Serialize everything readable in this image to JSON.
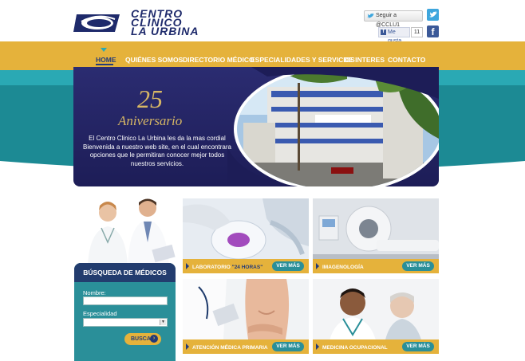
{
  "brand": {
    "line1": "CENTRO",
    "line2": "CLINICO",
    "line3": "LA URBINA"
  },
  "social": {
    "twitter_follow": "Seguir a @CCLU1",
    "facebook_like": "Me gusta",
    "facebook_count": "11",
    "facebook_letter": "f"
  },
  "nav": {
    "items": [
      {
        "label": "HOME"
      },
      {
        "label": "QUIÉNES SOMOS"
      },
      {
        "label": "DIRECTORIO MÉDICO"
      },
      {
        "label": "ESPECIALIDADES Y SERVICIOS"
      },
      {
        "label": "DE INTERES"
      },
      {
        "label": "CONTACTO"
      }
    ]
  },
  "hero": {
    "number": "25",
    "subtitle": "Aniversario",
    "text": "El Centro Clinico La Urbina les da la mas cordial Bienvenida a nuestro web site, en el cual encontrara opciones que le permitiran conocer mejor todos nuestros servicios."
  },
  "search": {
    "title": "BÚSQUEDA DE MÉDICOS",
    "name_label": "Nombre:",
    "name_value": "",
    "specialty_label": "Especialidad",
    "specialty_value": "",
    "button": "BUSCAR",
    "button_arrow": "›"
  },
  "services": [
    {
      "label": "LABORATORIO",
      "highlight": "\"24 HORAS\"",
      "button": "VER MÁS"
    },
    {
      "label": "IMAGENOLOGÍA",
      "highlight": "",
      "button": "VER MÁS"
    },
    {
      "label": "ATENCIÓN MÉDICA PRIMARIA",
      "highlight": "",
      "button": "VER MÁS"
    },
    {
      "label": "MEDICINA OCUPACIONAL",
      "highlight": "",
      "button": "VER MÁS"
    }
  ],
  "colors": {
    "navy": "#233a7a",
    "teal": "#2a8f99",
    "gold": "#e5b23b",
    "hero_bg": "#1d1d57"
  }
}
